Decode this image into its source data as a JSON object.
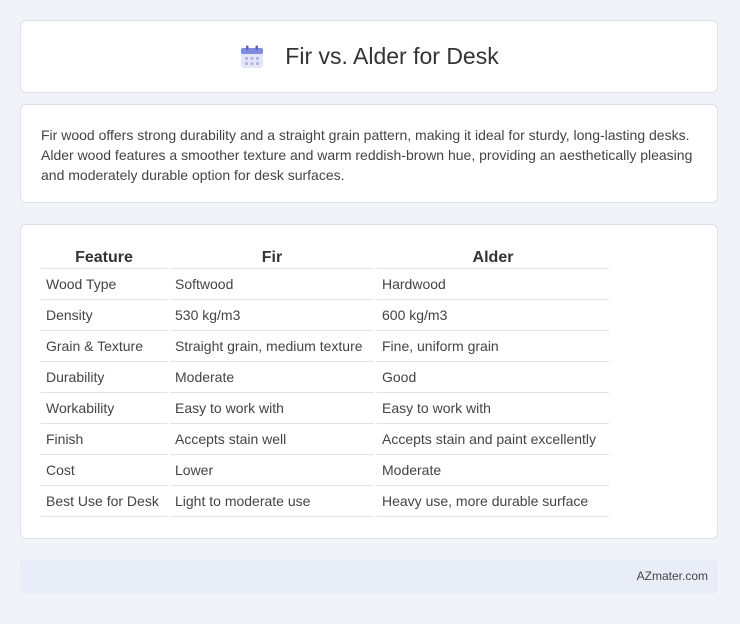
{
  "header": {
    "title": "Fir vs. Alder for Desk",
    "icon": "calendar-icon"
  },
  "description": "Fir wood offers strong durability and a straight grain pattern, making it ideal for sturdy, long-lasting desks. Alder wood features a smoother texture and warm reddish-brown hue, providing an aesthetically pleasing and moderately durable option for desk surfaces.",
  "table": {
    "headers": [
      "Feature",
      "Fir",
      "Alder"
    ],
    "rows": [
      [
        "Wood Type",
        "Softwood",
        "Hardwood"
      ],
      [
        "Density",
        "530 kg/m3",
        "600 kg/m3"
      ],
      [
        "Grain & Texture",
        "Straight grain, medium texture",
        "Fine, uniform grain"
      ],
      [
        "Durability",
        "Moderate",
        "Good"
      ],
      [
        "Workability",
        "Easy to work with",
        "Easy to work with"
      ],
      [
        "Finish",
        "Accepts stain well",
        "Accepts stain and paint excellently"
      ],
      [
        "Cost",
        "Lower",
        "Moderate"
      ],
      [
        "Best Use for Desk",
        "Light to moderate use",
        "Heavy use, more durable surface"
      ]
    ]
  },
  "footer": {
    "brand": "AZmater.com"
  }
}
